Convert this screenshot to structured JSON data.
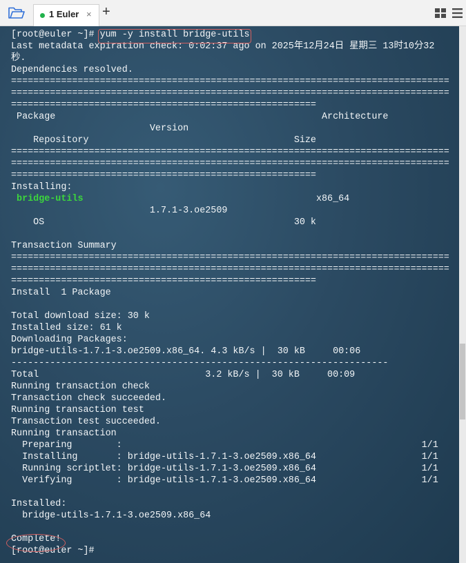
{
  "tabbar": {
    "tab_label": "1 Euler",
    "close_glyph": "×",
    "add_glyph": "+",
    "active_dot_color": "#22b24c"
  },
  "terminal": {
    "lines": [
      "[root@euler ~]# yum -y install bridge-utils",
      "Last metadata expiration check: 0:02:37 ago on 2025年12月24日 星期三 13时10分32",
      "秒.",
      "Dependencies resolved.",
      "===============================================================================",
      "===============================================================================",
      "=======================================================",
      " Package                                                Architecture",
      "                         Version",
      "    Repository                                     Size",
      "===============================================================================",
      "===============================================================================",
      "=======================================================",
      "Installing:",
      " bridge-utils                                          x86_64",
      "                         1.7.1-3.oe2509",
      "    OS                                             30 k",
      "",
      "Transaction Summary",
      "===============================================================================",
      "===============================================================================",
      "=======================================================",
      "Install  1 Package",
      "",
      "Total download size: 30 k",
      "Installed size: 61 k",
      "Downloading Packages:",
      "bridge-utils-1.7.1-3.oe2509.x86_64. 4.3 kB/s |  30 kB     00:06",
      "--------------------------------------------------------------------",
      "Total                              3.2 kB/s |  30 kB     00:09",
      "Running transaction check",
      "Transaction check succeeded.",
      "Running transaction test",
      "Transaction test succeeded.",
      "Running transaction",
      "  Preparing        :                                                      1/1",
      "  Installing       : bridge-utils-1.7.1-3.oe2509.x86_64                   1/1",
      "  Running scriptlet: bridge-utils-1.7.1-3.oe2509.x86_64                   1/1",
      "  Verifying        : bridge-utils-1.7.1-3.oe2509.x86_64                   1/1",
      "",
      "Installed:",
      "  bridge-utils-1.7.1-3.oe2509.x86_64",
      "",
      "Complete!",
      "[root@euler ~]#"
    ],
    "highlight_line_index": 14,
    "highlight_color": "#3cd63c",
    "annotation_color": "#d46060"
  }
}
